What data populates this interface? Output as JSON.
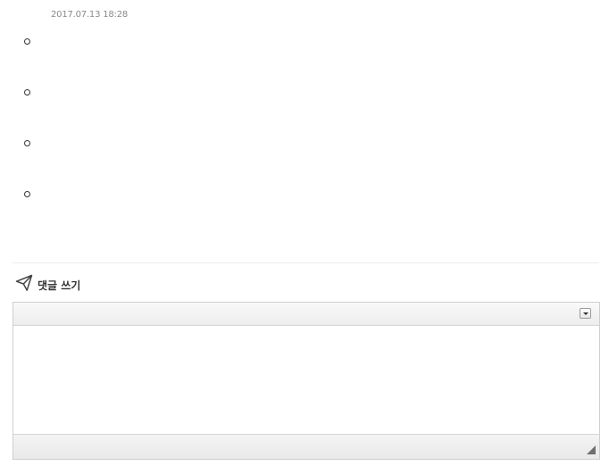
{
  "post": {
    "timestamp": "2017.07.13 18:28",
    "list_items": [
      "",
      "",
      "",
      ""
    ]
  },
  "comment_form": {
    "heading": "댓글 쓰기",
    "icon": "paper-plane-icon",
    "editor_value": ""
  },
  "colors": {
    "text": "#333333",
    "muted": "#8a8a8a",
    "border": "#cfcfcf"
  }
}
